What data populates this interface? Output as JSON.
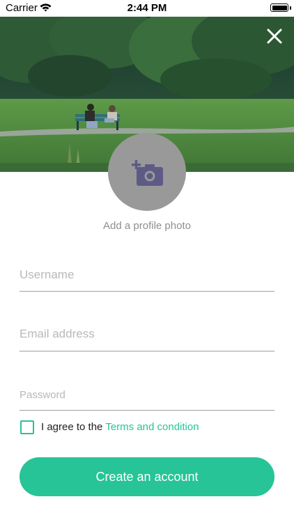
{
  "status_bar": {
    "carrier": "Carrier",
    "time": "2:44 PM"
  },
  "profile": {
    "add_photo_label": "Add a profile photo"
  },
  "form": {
    "username_placeholder": "Username",
    "email_placeholder": "Email address",
    "password_placeholder": "Password",
    "agree_text": "I agree to the",
    "terms_link": "Terms and condition",
    "terms_checked": false
  },
  "actions": {
    "create_account_label": "Create an account"
  },
  "icons": {
    "close": "close-icon",
    "camera": "add-photo-camera-icon"
  },
  "colors": {
    "accent": "#26c497",
    "avatar_bg": "#999999",
    "camera_icon": "#5d5b86"
  }
}
